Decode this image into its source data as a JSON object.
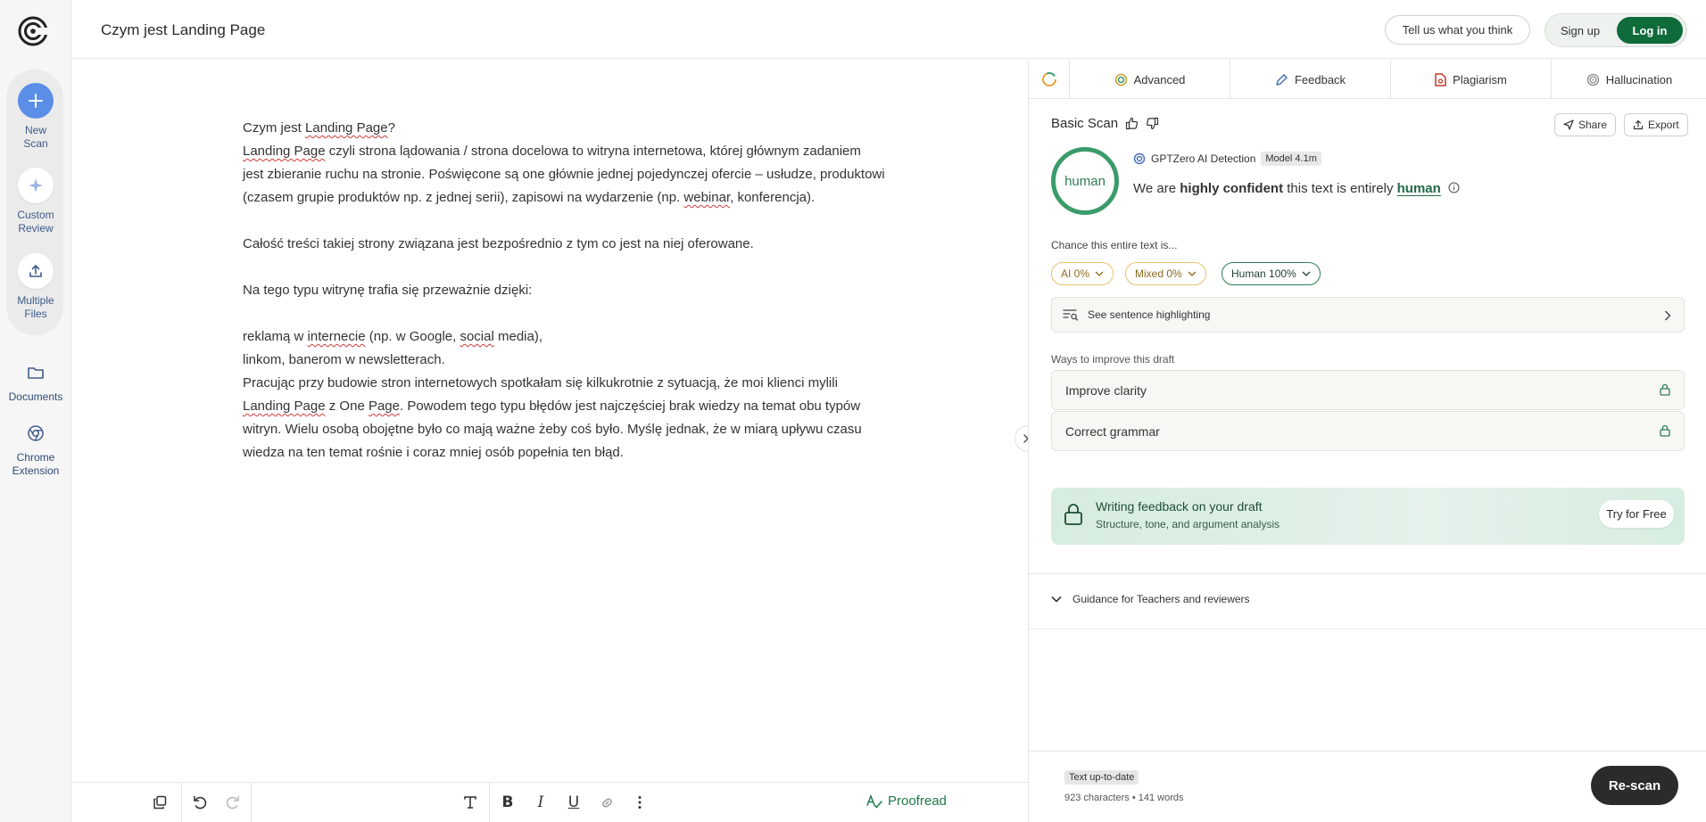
{
  "rail": {
    "new_scan": "New Scan",
    "custom_review": "Custom Review",
    "multiple_files": "Multiple Files",
    "documents": "Documents",
    "chrome_extension": "Chrome Extension"
  },
  "header": {
    "doc_title": "Czym jest Landing Page",
    "feedback_label": "Tell us what you think",
    "signup_label": "Sign up",
    "login_label": "Log in"
  },
  "editor": {
    "p1": "Czym jest ",
    "p1_sq": "Landing Page",
    "p1_end": "?",
    "p2_sq": "Landing Page",
    "p2_rest": " czyli strona lądowania / strona docelowa to witryna internetowa, której głównym zadaniem jest zbieranie ruchu na stronie. Poświęcone są one głównie jednej pojedynczej ofercie – usłudze, produktowi (czasem grupie produktów np. z jednej serii), zapisowi na wydarzenie (np. ",
    "p2_sq2": "webinar",
    "p2_end": ", konferencja).",
    "p3": "Całość treści takiej strony związana jest bezpośrednio z tym co jest na niej oferowane.",
    "p4": "Na tego typu witrynę trafia się przeważnie dzięki:",
    "p5_a": "reklamą w ",
    "p5_sq": "internecie",
    "p5_b": " (np. w Google, ",
    "p5_sq2": "social",
    "p5_c": " media),",
    "p6": "linkom, banerom w newsletterach.",
    "p7_a": "Pracując przy budowie stron internetowych spotkałam się kilkukrotnie z sytuacją, że moi klienci mylili ",
    "p7_sq": "Landing Page",
    "p7_b": " z One ",
    "p7_sq2": "Page",
    "p7_c": ". Powodem tego typu błędów jest najczęściej brak wiedzy na temat obu typów witryn. Wielu osobą obojętne było co mają ważne żeby coś było. Myślę jednak, że w miarą upływu czasu wiedza na ten temat rośnie i coraz mniej osób popełnia ten błąd."
  },
  "toolbar": {
    "proofread_label": "Proofread"
  },
  "panel": {
    "tabs": [
      "Advanced",
      "Feedback",
      "Plagiarism",
      "Hallucination"
    ],
    "scan_title": "Basic Scan",
    "share_label": "Share",
    "export_label": "Export",
    "ring_label": "human",
    "detector_label": "GPTZero AI Detection",
    "model_badge": "Model 4.1m",
    "verdict_a": "We are ",
    "verdict_b": "highly confident",
    "verdict_c": " this text is entirely ",
    "verdict_d": "human",
    "chance_label": "Chance this entire text is...",
    "chips": {
      "ai": "AI 0%",
      "mixed": "Mixed 0%",
      "human": "Human 100%"
    },
    "highlight_label": "See sentence highlighting",
    "ways_label": "Ways to improve this draft",
    "improve": [
      "Improve clarity",
      "Correct grammar"
    ],
    "promo_title": "Writing feedback on your draft",
    "promo_sub": "Structure, tone, and argument analysis",
    "try_label": "Try for Free",
    "guidance_label": "Guidance for Teachers and reviewers",
    "status_badge": "Text up-to-date",
    "counts": "923 characters • 141 words",
    "rescan_label": "Re-scan"
  },
  "colors": {
    "accent_green": "#0f6b3a",
    "human_ring": "#3b9b6a",
    "ai_chip": "#e8c36b",
    "new_scan_blue": "#5b8ee6"
  }
}
